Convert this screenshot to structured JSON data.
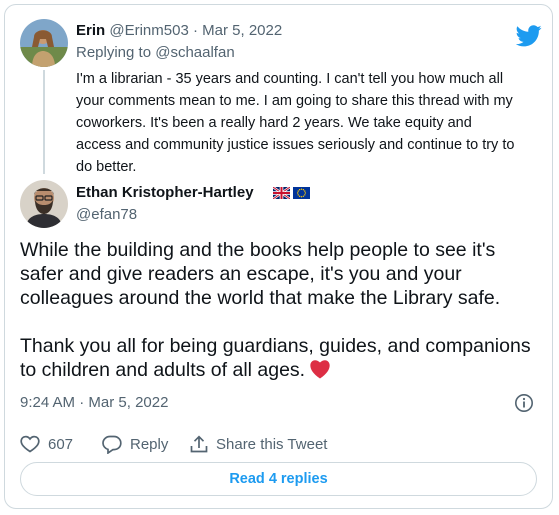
{
  "reply_tweet": {
    "author_name": "Erin",
    "author_handle": "@Erinm503",
    "date_separator": "·",
    "date": "Mar 5, 2022",
    "replying_label": "Replying to",
    "replying_handle": "@schaalfan",
    "body": "I'm a librarian - 35 years and counting. I can't tell you how much all your comments mean to me. I am going to share this thread with my coworkers. It's been a really hard 2 years. We take equity and access and community justice issues seriously and continue to try to do better."
  },
  "main_tweet": {
    "author_name": "Ethan Kristopher-Hartley",
    "author_handle": "@efan78",
    "flags": [
      "uk-flag-icon",
      "eu-flag-icon"
    ],
    "paragraph1": "While the building and the books help people to see it's safer and give readers an escape, it's you and your colleagues around the world that make the Library safe.",
    "paragraph2": "Thank you all for being guardians, guides, and companions to children and adults of all ages.",
    "time": "9:24 AM",
    "time_separator": "·",
    "date": "Mar 5, 2022"
  },
  "actions": {
    "like_count": "607",
    "reply_label": "Reply",
    "share_label": "Share this Tweet"
  },
  "read_replies_label": "Read 4 replies",
  "colors": {
    "accent": "#1d9bf0",
    "heart": "#e0245e",
    "muted": "#536471",
    "border": "#cfd9de"
  },
  "icons": [
    "twitter-bird-icon",
    "info-icon",
    "heart-outline-icon",
    "reply-bubble-icon",
    "share-upload-icon",
    "red-heart-emoji"
  ]
}
